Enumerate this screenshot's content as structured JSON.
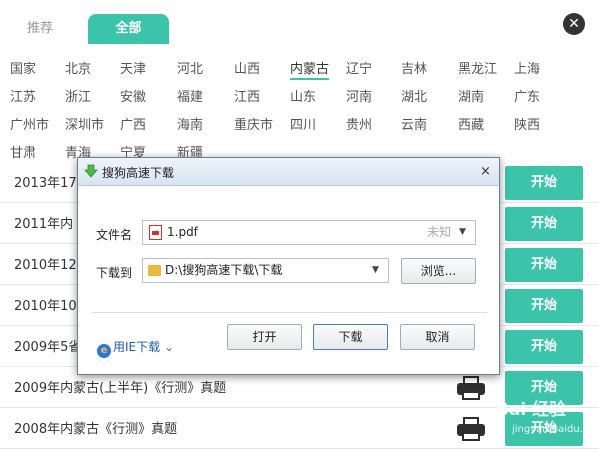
{
  "tabs": {
    "recommend": "推荐",
    "all": "全部"
  },
  "close_icon": "close-icon",
  "regions": [
    "国家",
    "北京",
    "天津",
    "河北",
    "山西",
    "内蒙古",
    "辽宁",
    "吉林",
    "黑龙江",
    "上海",
    "江苏",
    "浙江",
    "安徽",
    "福建",
    "江西",
    "山东",
    "河南",
    "湖北",
    "湖南",
    "广东",
    "广州市",
    "深圳市",
    "广西",
    "海南",
    "重庆市",
    "四川",
    "贵州",
    "云南",
    "西藏",
    "陕西",
    "甘肃",
    "青海",
    "宁夏",
    "新疆"
  ],
  "active_region": "内蒙古",
  "rows": [
    {
      "title": "2013年17",
      "button": "开始"
    },
    {
      "title": "2011年内",
      "button": "开始"
    },
    {
      "title": "2010年12",
      "button": "开始"
    },
    {
      "title": "2010年10",
      "button": "开始"
    },
    {
      "title": "2009年5省",
      "button": "开始"
    },
    {
      "title": "2009年内蒙古(上半年)《行测》真题",
      "button": "开始"
    },
    {
      "title": "2008年内蒙古《行测》真题",
      "button": "开始"
    }
  ],
  "dialog": {
    "title": "搜狗高速下载",
    "close": "×",
    "filename_label": "文件名",
    "filename": "1.pdf",
    "size": "未知",
    "saveto_label": "下载到",
    "path": "D:\\搜狗高速下载\\下载",
    "browse": "浏览...",
    "ie_download": "用IE下载",
    "open": "打开",
    "download": "下载",
    "cancel": "取消"
  },
  "watermark": {
    "main": "Bai 经验",
    "sub": "jingyan.baidu.com"
  },
  "colors": {
    "accent": "#3cc4aa",
    "folder": "#e9b93a"
  }
}
